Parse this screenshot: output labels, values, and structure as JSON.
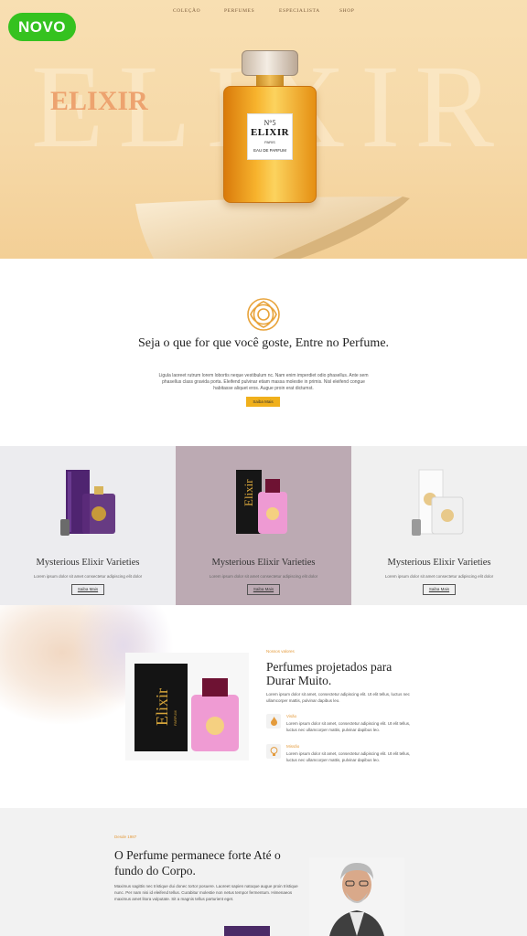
{
  "badge": "NOVO",
  "nav": {
    "items": [
      "COLEÇÃO",
      "PERFUMES",
      "ESPECIALISTA",
      "SHOP"
    ]
  },
  "hero": {
    "big_word": "ELIXIR",
    "small_word": "ELIXIR",
    "bottle_label": {
      "number": "N°5",
      "name": "ELIXIR",
      "city": "PARIS",
      "type": "EAU DE PARFUM"
    }
  },
  "intro": {
    "title": "Seja o que for que você goste, Entre no Perfume.",
    "text": "Ligula laoreet rutrum lorem lobortis neque vestibulum nc. Nam enim imperdiet odio phasellus. Ante sem phasellus class gravida porta. Eleifend pulvinar etiam massa molestie in primis. Nisl eleifend congue habitasse aliquet eros. Augue proin erat dictumst.",
    "button": "Saiba Mais"
  },
  "products": [
    {
      "name": "Mysterious Elixir Varieties",
      "desc": "Lorem ipsum dolor sit amet consectetur adipiscing elit dolor",
      "button": "Saiba Mais",
      "color": "#5b2b7a"
    },
    {
      "name": "Mysterious Elixir Varieties",
      "desc": "Lorem ipsum dolor sit amet consectetur adipiscing elit dolor",
      "button": "Saiba Mais",
      "color": "#e58fc8"
    },
    {
      "name": "Mysterious Elixir Varieties",
      "desc": "Lorem ipsum dolor sit amet consectetur adipiscing elit dolor",
      "button": "Saiba Mais",
      "color": "#d9d9d9"
    }
  ],
  "feature": {
    "kicker": "Nossos valores",
    "title": "Perfumes projetados para Durar Muito.",
    "text": "Lorem ipsum dolor sit amet, consectetur adipiscing elit. Ut elit tellus, luctus nec ullamcorper mattis, pulvinar dapibus leo.",
    "box_word": "Elixir",
    "box_sub": "PARFUM",
    "items": [
      {
        "icon": "flame-icon",
        "title": "Visão",
        "text": "Lorem ipsum dolor sit amet, consectetur adipiscing elit. Ut elit tellus, luctus nec ullamcorper mattis, pulvinar dapibus leo."
      },
      {
        "icon": "lightbulb-icon",
        "title": "Missão",
        "text": "Lorem ipsum dolor sit amet, consectetur adipiscing elit. Ut elit tellus, luctus nec ullamcorper mattis, pulvinar dapibus leo."
      }
    ]
  },
  "story": {
    "kicker": "Desde 1987",
    "title": "O Perfume permanece forte Até o fundo do Corpo.",
    "text": "Maximus sagittis nec tristique dui donec tortor posuere. Laoreet sapien natoque augue proin tristique nunc. Per nam nisi id eleifend tellus. Curabitur molestie non netus tempor fermentum. Himenaeos maximus amet litora vulputate. Sit a magnis tellus parturient eget."
  },
  "colors": {
    "accent": "#f0b01c",
    "badge": "#35c21f",
    "orange_text": "#e49b3c"
  }
}
